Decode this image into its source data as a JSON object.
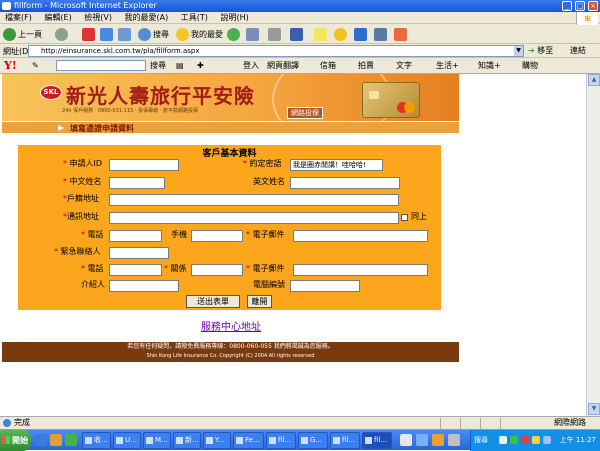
{
  "window": {
    "title": "fillform - Microsoft Internet Explorer"
  },
  "menu": [
    "檔案(F)",
    "編輯(E)",
    "檢視(V)",
    "我的最愛(A)",
    "工具(T)",
    "說明(H)"
  ],
  "toolbar": {
    "back": "上一頁",
    "search": "搜尋",
    "favorites": "我的最愛"
  },
  "address": {
    "label": "網址(D)",
    "url": "http://einsurance.skl.com.tw/pla/fillform.aspx",
    "go": "移至",
    "links": "連結"
  },
  "yahoo": {
    "logo": "Y!",
    "search_btn": "搜尋",
    "signin": "登入",
    "items": [
      "網頁翻譯",
      "信箱",
      "拍賣",
      "文字",
      "生活+",
      "知識+",
      "購物"
    ]
  },
  "banner": {
    "logo_text": "SKL",
    "title": "新光人壽旅行平安險",
    "subtitle": "24h 保戶服務 ‧ 0800-031-115 ‧ 投保專線 ‧ 旅平險網路投保",
    "stamp": "網路投保",
    "step": "填寫憑證申請資料"
  },
  "form": {
    "heading": "客戶基本資料",
    "applicant_id": "申請人ID",
    "password_label": "約定密語",
    "password_value": "我是圈赤閒講！哇哈哈!",
    "cn_name": "中文姓名",
    "en_name": "英文姓名",
    "household_addr": "戶籍地址",
    "mail_addr": "通訊地址",
    "same_label": "同上",
    "phone": "電話",
    "mobile": "手機",
    "email": "電子郵件",
    "emergency": "緊急聯絡人",
    "relation": "關係",
    "introducer": "介紹人",
    "computer_no": "電腦編號",
    "submit": "送出表單",
    "leave": "離開"
  },
  "service_link": "服務中心地址",
  "footer": {
    "line1": "若您有任何疑問，請撥免費服務專線：0800-060-055 我們將竭誠為您服務。",
    "line2": "Shin Kong Life Insurance Co. Copyright (C) 2004 All rights reserved"
  },
  "status": {
    "left": "完成",
    "right": "網際網路"
  },
  "taskbar": {
    "start": "開始",
    "tasks": [
      "收...",
      "U...",
      "M...",
      "新...",
      "Y...",
      "Fe...",
      "fil...",
      "G...",
      "fil...",
      "fil..."
    ],
    "search": "搜尋",
    "clock": "上午 11:27"
  }
}
